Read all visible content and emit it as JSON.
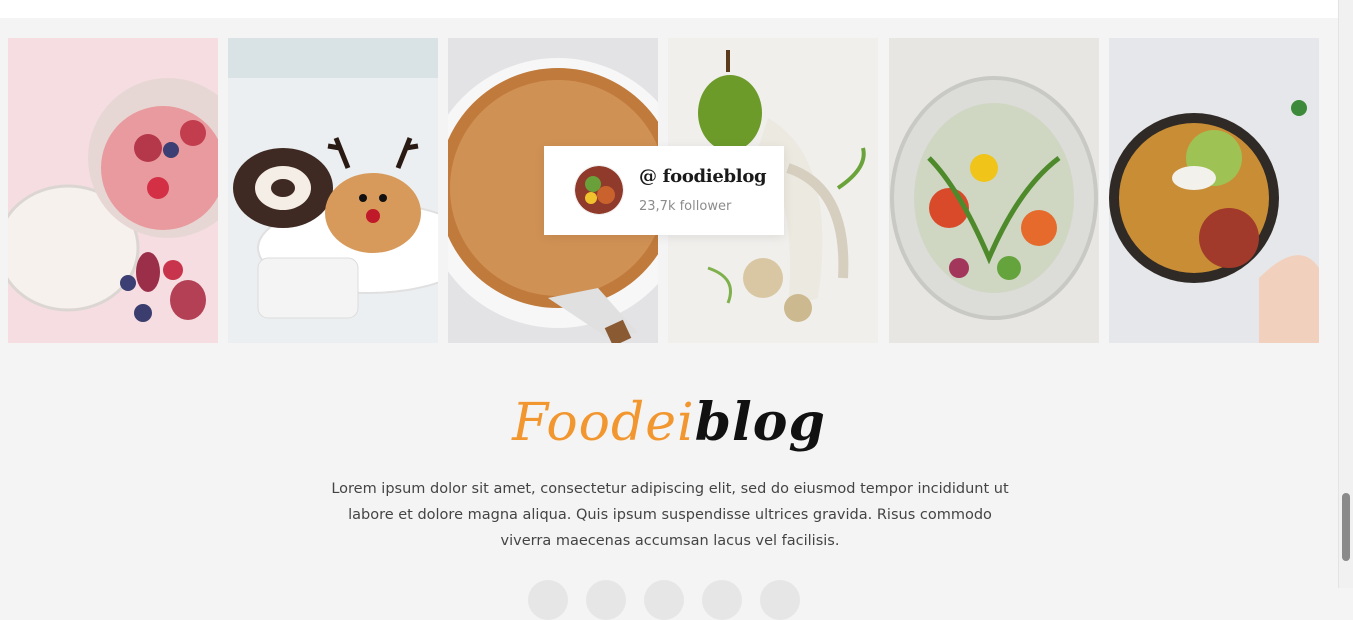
{
  "profile": {
    "handle": "@ foodieblog",
    "followers": "23,7k follower"
  },
  "brand": {
    "part_colored": "Foodei",
    "part_dark": "blog",
    "accent_color": "#f2962f"
  },
  "about": {
    "text": "Lorem ipsum dolor sit amet, consectetur adipiscing elit, sed do eiusmod tempor incididunt ut labore et dolore magna aliqua. Quis ipsum suspendisse ultrices gravida. Risus commodo viverra maecenas accumsan lacus vel facilisis."
  },
  "gallery": {
    "images": [
      {
        "name": "chia pudding jar with figs"
      },
      {
        "name": "reindeer cake with swiss roll"
      },
      {
        "name": "pumpkin pie"
      },
      {
        "name": "pear dessert with crumble"
      },
      {
        "name": "salad in glass"
      },
      {
        "name": "potatoes with guacamole"
      }
    ]
  },
  "social_icons": [
    "social-icon-1",
    "social-icon-2",
    "social-icon-3",
    "social-icon-4",
    "social-icon-5"
  ]
}
